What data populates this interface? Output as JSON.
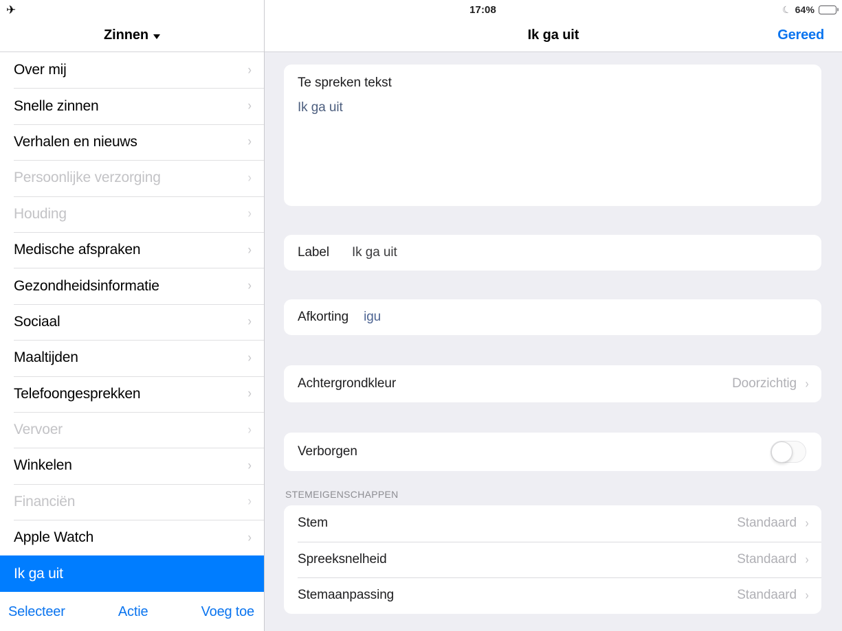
{
  "status_bar": {
    "left_icon": "airplane-mode-icon",
    "time": "17:08",
    "dnd_icon": "moon-icon",
    "battery_percent": "64%",
    "battery_level": 64
  },
  "sidebar": {
    "title": "Zinnen",
    "title_caret": "chevron-down-icon",
    "items": [
      {
        "label": "Over mij",
        "dim": false,
        "selected": false
      },
      {
        "label": "Snelle zinnen",
        "dim": false,
        "selected": false
      },
      {
        "label": "Verhalen en nieuws",
        "dim": false,
        "selected": false
      },
      {
        "label": "Persoonlijke verzorging",
        "dim": true,
        "selected": false
      },
      {
        "label": "Houding",
        "dim": true,
        "selected": false
      },
      {
        "label": "Medische afspraken",
        "dim": false,
        "selected": false
      },
      {
        "label": "Gezondheidsinformatie",
        "dim": false,
        "selected": false
      },
      {
        "label": "Sociaal",
        "dim": false,
        "selected": false
      },
      {
        "label": "Maaltijden",
        "dim": false,
        "selected": false
      },
      {
        "label": "Telefoongesprekken",
        "dim": false,
        "selected": false
      },
      {
        "label": "Vervoer",
        "dim": true,
        "selected": false
      },
      {
        "label": "Winkelen",
        "dim": false,
        "selected": false
      },
      {
        "label": "Financiën",
        "dim": true,
        "selected": false
      },
      {
        "label": "Apple Watch",
        "dim": false,
        "selected": false
      },
      {
        "label": "Ik ga uit",
        "dim": false,
        "selected": true
      }
    ],
    "toolbar": {
      "select": "Selecteer",
      "action": "Actie",
      "add": "Voeg toe"
    }
  },
  "main": {
    "title": "Ik ga uit",
    "done_label": "Gereed",
    "spoken_text": {
      "title": "Te spreken tekst",
      "value": "Ik ga uit"
    },
    "label_field": {
      "label": "Label",
      "value": "Ik ga uit"
    },
    "abbreviation_field": {
      "label": "Afkorting",
      "value": "igu"
    },
    "background_color": {
      "label": "Achtergrondkleur",
      "value": "Doorzichtig"
    },
    "hidden_toggle": {
      "label": "Verborgen",
      "state": "off"
    },
    "voice_section": {
      "header": "STEMEIGENSCHAPPEN",
      "rows": [
        {
          "label": "Stem",
          "value": "Standaard"
        },
        {
          "label": "Spreeksnelheid",
          "value": "Standaard"
        },
        {
          "label": "Stemaanpassing",
          "value": "Standaard"
        }
      ]
    }
  },
  "colors": {
    "accent_blue": "#0a74ef",
    "selection_blue": "#007dff",
    "group_background": "#eeeef3",
    "card_white": "#ffffff",
    "dim_gray": "#c3c3c6",
    "value_gray": "#b0b0b5"
  }
}
